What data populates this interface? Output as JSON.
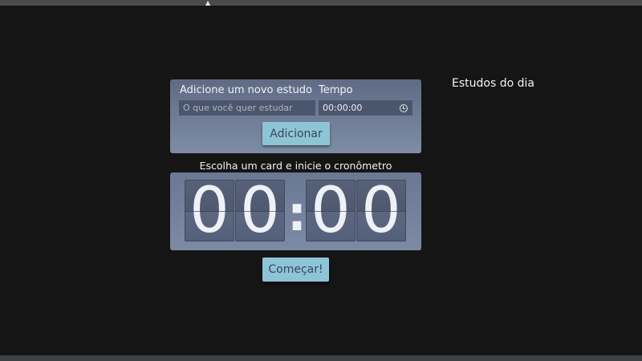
{
  "form": {
    "study_label": "Adicione um novo estudo",
    "time_label": "Tempo",
    "study_placeholder": "O que você quer estudar",
    "time_value": "00:00:00",
    "add_button": "Adicionar"
  },
  "timer": {
    "instruction": "Escolha um card e inicie o cronômetro",
    "digits": [
      "00",
      "00"
    ],
    "separator": ":",
    "start_button": "Começar!"
  },
  "sidebar": {
    "title": "Estudos do dia"
  },
  "icons": {
    "time_field_icon": "clock-icon"
  },
  "colors": {
    "background": "#151516",
    "card": "#6a7893",
    "button": "#8ec5d6"
  }
}
